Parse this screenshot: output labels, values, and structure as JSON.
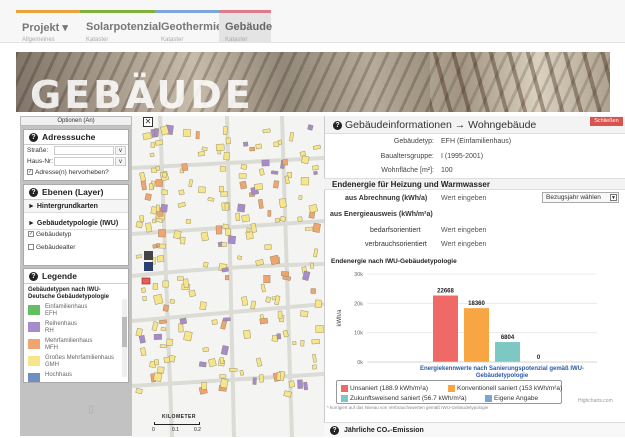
{
  "nav": {
    "tabs": [
      {
        "label": "Projekt ▾",
        "sub": "Allgemeines",
        "color": "#e8a33a"
      },
      {
        "label": "Solarpotenzial",
        "sub": "Kataster",
        "color": "#7fb13a"
      },
      {
        "label": "Geothermie",
        "sub": "Kataster",
        "color": "#7aa7d8"
      },
      {
        "label": "Gebäude",
        "sub": "Kataster",
        "color": "#e07a8a",
        "active": true
      }
    ]
  },
  "banner": {
    "title": "GEBÄUDE"
  },
  "left": {
    "options_tab": "Optionen (An)",
    "address": {
      "title": "Adresssuche",
      "street_label": "Straße:",
      "housenr_label": "Haus-Nr:",
      "btn_caret": "v",
      "highlight_checked": true,
      "highlight_label": "Adresse(n) hervorheben?"
    },
    "layers": {
      "title": "Ebenen (Layer)",
      "background": "► Hintergrundkarten",
      "typology": "► Gebäudetypologie (IWU)",
      "check_type": "Gebäudetyp",
      "check_type_checked": true,
      "check_age": "Gebäudealter",
      "check_age_checked": false
    },
    "legend": {
      "title": "Legende",
      "subtitle": "Gebäudetypen nach IWU-Deutsche Gebäudetypologie",
      "items": [
        {
          "l1": "Einfamilienhaus",
          "l2": "EFH",
          "color": "#5fbf62"
        },
        {
          "l1": "Reihenhaus",
          "l2": "RH",
          "color": "#a68bcd"
        },
        {
          "l1": "Mehrfamilienhaus",
          "l2": "MFH",
          "color": "#f0a470"
        },
        {
          "l1": "Großes Mehrfamilienhaus",
          "l2": "GMH",
          "color": "#f6e58b"
        },
        {
          "l1": "Hochhaus",
          "l2": "",
          "color": "#6f8fc4"
        }
      ]
    }
  },
  "map": {
    "scale_label": "KILOMETER",
    "scale_ticks": [
      "0",
      "0.1",
      "0.2"
    ]
  },
  "info": {
    "title": "Gebäudeinformationen → Wohngebäude",
    "close": "Schließen",
    "fields": [
      {
        "k": "Gebäudetyp:",
        "v": "EFH (Einfamilienhaus)"
      },
      {
        "k": "Baualtersgruppe:",
        "v": "I (1995-2001)"
      },
      {
        "k": "Wohnfläche [m²]:",
        "v": "100"
      }
    ],
    "energy_title": "Endenergie für Heizung und Warmwasser",
    "abrechnung_label": "aus Abrechnung (kWh/a)",
    "placeholder": "Wert eingeben",
    "year_select": "Bezugsjahr wählen",
    "ausweis_label": "aus Energieausweis (kWh/m²a)",
    "bedarf_label": "bedarfsorientiert",
    "verbrauch_label": "verbrauchsorientiert",
    "footnote": "* korrigiert auf das Niveau von Verbrauchswerten gemäß IWU-Gebäudetypologie",
    "credits": "Highcharts.com",
    "bottom_title": "Jährliche CO₂-Emission"
  },
  "chart_data": {
    "type": "bar",
    "title": "Endenergie nach IWU-Gebäudetypologie",
    "ylabel": "kWh/a",
    "xlabel": "Energiekennwerte nach Sanierungspotenzial gemäß IWU-Gebäudetypologie",
    "ylim": [
      0,
      30000
    ],
    "yticks": [
      "0k",
      "10k",
      "20k",
      "30k"
    ],
    "grid": true,
    "legend_position": "bottom",
    "categories": [
      "Unsaniert (188.9 kWh/m²a)",
      "Konventionell saniert (153 kWh/m²a)",
      "Zukunftsweisend saniert (56.7 kWh/m²a)",
      "Eigene Angabe"
    ],
    "values": [
      22668,
      18360,
      6804,
      0
    ],
    "colors": [
      "#ef6a67",
      "#f8a644",
      "#7ec8c4",
      "#7aa6d4"
    ]
  }
}
